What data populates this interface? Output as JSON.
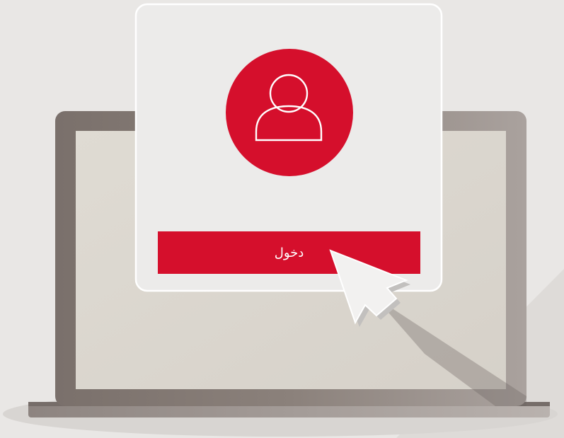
{
  "login": {
    "button_label": "دخول"
  },
  "icons": {
    "user": "user-icon",
    "cursor": "mouse-cursor-icon"
  },
  "colors": {
    "background": "#e9e7e5",
    "accent_red": "#d50f2c",
    "laptop_frame": "#7b716c",
    "laptop_screen": "#dcd8d0",
    "card": "#ecebea"
  }
}
